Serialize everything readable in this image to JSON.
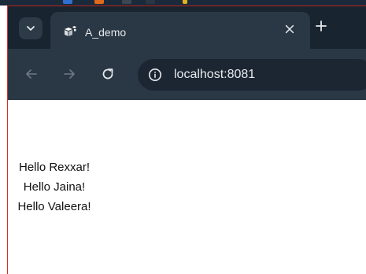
{
  "browser": {
    "tab": {
      "title": "A_demo"
    },
    "address_bar": {
      "url": "localhost:8081"
    }
  },
  "page": {
    "messages": [
      "Hello Rexxar!",
      "Hello Jaina!",
      "Hello Valeera!"
    ]
  },
  "colors": {
    "tabstrip": "#182430",
    "toolbar": "#2a3744",
    "omnibox": "#1b2632",
    "border_accent": "#d93025"
  },
  "icons": {
    "tab_search": "chevron-down-icon",
    "favicon": "puzzle-favicon",
    "close": "close-icon",
    "new_tab": "plus-icon",
    "back": "arrow-left-icon",
    "forward": "arrow-right-icon",
    "reload": "reload-icon",
    "site_info": "info-icon"
  }
}
